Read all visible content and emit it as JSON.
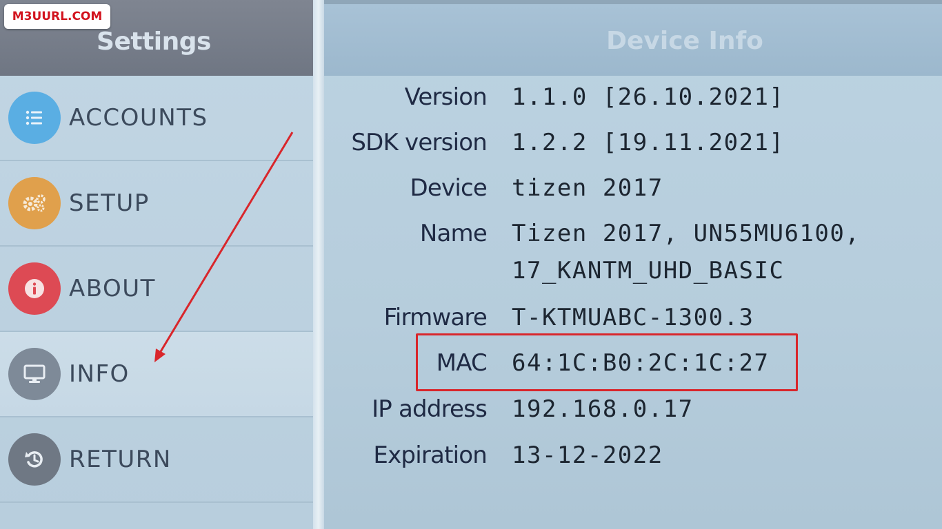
{
  "watermark": "M3UURL.COM",
  "settings_panel": {
    "title": "Settings",
    "items": [
      {
        "label": "ACCOUNTS",
        "icon": "list-icon",
        "color": "#5aaee3"
      },
      {
        "label": "SETUP",
        "icon": "gears-icon",
        "color": "#e0a04c"
      },
      {
        "label": "ABOUT",
        "icon": "info-icon",
        "color": "#dd4a54"
      },
      {
        "label": "INFO",
        "icon": "monitor-icon",
        "color": "#7e8a98"
      },
      {
        "label": "RETURN",
        "icon": "return-icon",
        "color": "#6f7884"
      }
    ],
    "selected": "INFO"
  },
  "device_info": {
    "title": "Device Info",
    "rows": [
      {
        "label": "Version",
        "value": "1.1.0 [26.10.2021]"
      },
      {
        "label": "SDK version",
        "value": "1.2.2 [19.11.2021]"
      },
      {
        "label": "Device",
        "value": "tizen 2017"
      },
      {
        "label": "Name",
        "value": "Tizen 2017, UN55MU6100,",
        "value2": "17_KANTM_UHD_BASIC"
      },
      {
        "label": "Firmware",
        "value": "T-KTMUABC-1300.3"
      },
      {
        "label": "MAC",
        "value": "64:1C:B0:2C:1C:27"
      },
      {
        "label": "IP address",
        "value": "192.168.0.17"
      },
      {
        "label": "Expiration",
        "value": "13-12-2022"
      }
    ]
  },
  "annotation_color": "#d9262b"
}
